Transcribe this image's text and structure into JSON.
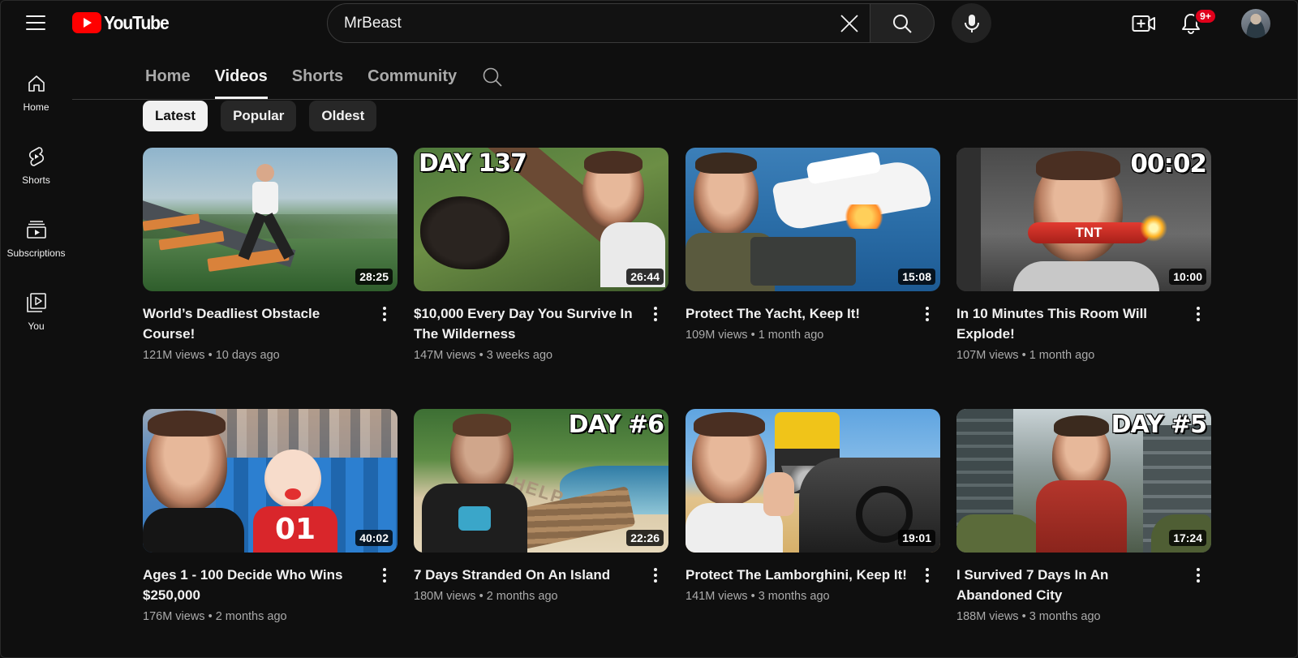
{
  "header": {
    "logo_text": "YouTube",
    "search_value": "MrBeast",
    "notification_count": "9+",
    "colors": {
      "brand_red": "#ff0000",
      "badge_red": "#e0001b"
    }
  },
  "sidebar": {
    "items": [
      {
        "label": "Home",
        "icon": "home-icon"
      },
      {
        "label": "Shorts",
        "icon": "shorts-icon"
      },
      {
        "label": "Subscriptions",
        "icon": "subscriptions-icon"
      },
      {
        "label": "You",
        "icon": "you-icon"
      }
    ]
  },
  "channel_tabs": {
    "tabs": [
      "Home",
      "Videos",
      "Shorts",
      "Community"
    ],
    "active": "Videos"
  },
  "filters": {
    "chips": [
      "Latest",
      "Popular",
      "Oldest"
    ],
    "active": "Latest"
  },
  "videos": [
    {
      "title": "World’s Deadliest Obstacle Course!",
      "duration": "28:25",
      "views": "121M views",
      "age": "10 days ago",
      "overlay": ""
    },
    {
      "title": "$10,000 Every Day You Survive In The Wilderness",
      "duration": "26:44",
      "views": "147M views",
      "age": "3 weeks ago",
      "overlay": "DAY 137"
    },
    {
      "title": "Protect The Yacht, Keep It!",
      "duration": "15:08",
      "views": "109M views",
      "age": "1 month ago",
      "overlay": ""
    },
    {
      "title": "In 10 Minutes This Room Will Explode!",
      "duration": "10:00",
      "views": "107M views",
      "age": "1 month ago",
      "overlay": "00:02"
    },
    {
      "title": "Ages 1 - 100 Decide Who Wins $250,000",
      "duration": "40:02",
      "views": "176M views",
      "age": "2 months ago",
      "overlay": "01"
    },
    {
      "title": "7 Days Stranded On An Island",
      "duration": "22:26",
      "views": "180M views",
      "age": "2 months ago",
      "overlay": "DAY #6"
    },
    {
      "title": "Protect The Lamborghini, Keep It!",
      "duration": "19:01",
      "views": "141M views",
      "age": "3 months ago",
      "overlay": ""
    },
    {
      "title": "I Survived 7 Days In An Abandoned City",
      "duration": "17:24",
      "views": "188M views",
      "age": "3 months ago",
      "overlay": "DAY #5"
    }
  ],
  "stat_separator": "•",
  "tnt_label": "TNT",
  "beach_text": "HELP"
}
